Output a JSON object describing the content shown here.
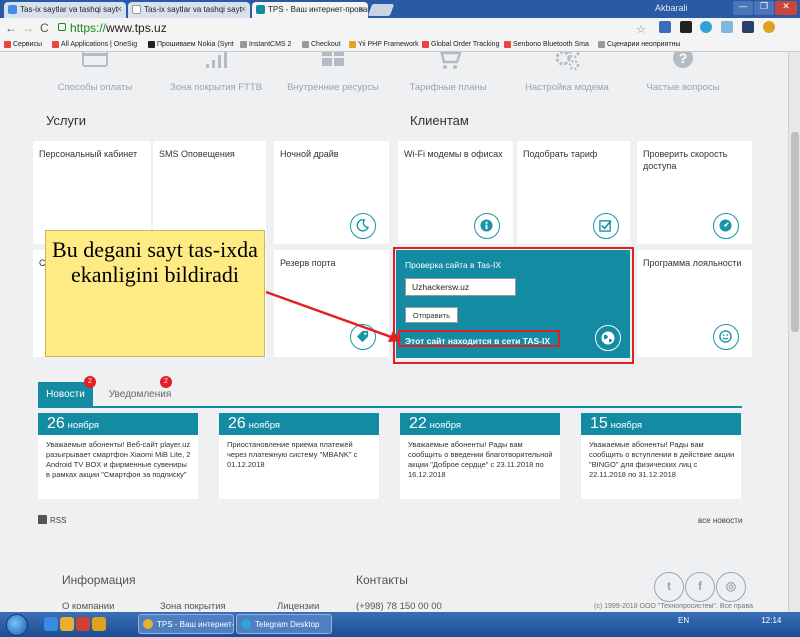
{
  "browser": {
    "tabs": [
      {
        "label": "Tas-ix saytlar va tashqi sayt"
      },
      {
        "label": "Tas-ix saytlar va tashqi sayt"
      },
      {
        "label": "TPS - Ваш интернет-провай"
      }
    ],
    "user": "Akbarali",
    "url_scheme": "https://",
    "url_host": "www.tps.uz",
    "bookmarks": [
      {
        "label": "Сервисы",
        "color": "#e8453c"
      },
      {
        "label": "All Applications | OneSig",
        "color": "#e8453c"
      },
      {
        "label": "Прошиваем Nokia (Synt",
        "color": "#222222"
      },
      {
        "label": "InstantCMS 2",
        "color": "#999999"
      },
      {
        "label": "Checkout",
        "color": "#999999"
      },
      {
        "label": "Yii PHP Framework",
        "color": "#e8a020"
      },
      {
        "label": "Global Order Tracking",
        "color": "#e8453c"
      },
      {
        "label": "Senbono Bluetooth Sma",
        "color": "#e8453c"
      },
      {
        "label": "Сценарии неоприятны",
        "color": "#999999"
      }
    ]
  },
  "topnav": [
    {
      "label": "Способы оплаты",
      "icon": "card-icon"
    },
    {
      "label": "Зона покрытия FTTB",
      "icon": "signal-icon"
    },
    {
      "label": "Внутренние ресурсы",
      "icon": "grid-icon"
    },
    {
      "label": "Тарифные планы",
      "icon": "cart-icon"
    },
    {
      "label": "Настройка модема",
      "icon": "gears-icon"
    },
    {
      "label": "Частые вопросы",
      "icon": "question-icon"
    }
  ],
  "sections": {
    "services": "Услуги",
    "clients": "Клиентам"
  },
  "cards_row1": [
    {
      "label": "Персональный кабинет",
      "icon": "login-icon"
    },
    {
      "label": "SMS Оповещения",
      "icon": "mail-icon"
    },
    {
      "label": "Ночной драйв",
      "icon": "moon-icon"
    },
    {
      "label": "Wi-Fi модемы в офисах",
      "icon": "info-icon"
    },
    {
      "label": "Подобрать тариф",
      "icon": "checkbox-icon"
    },
    {
      "label": "Проверить скорость доступа",
      "icon": "speedometer-icon"
    }
  ],
  "cards_row2": [
    {
      "label": "Ст",
      "icon": ""
    },
    {
      "label": "Резерв порта",
      "icon": "tag-icon"
    },
    {
      "label": "Программа лояльности",
      "icon": "smile-icon"
    }
  ],
  "tasix": {
    "title": "Проверка сайта в Tas-IX",
    "input_value": "Uzhackersw.uz",
    "submit_label": "Отправить",
    "result": "Этот сайт находится в сети TAS-IX",
    "accent": "#138ba2"
  },
  "annotation": {
    "text": "Bu degani sayt tas-ixda ekanligini bildiradi",
    "arrow_color": "#e31e24"
  },
  "news": {
    "tabs": [
      {
        "label": "Новости",
        "badge": "2"
      },
      {
        "label": "Уведомления",
        "badge": "2"
      }
    ],
    "items": [
      {
        "day": "26",
        "month": "ноября",
        "text": "Уважаемые абоненты! Веб-сайт player.uz разыгрывает смартфон Xiaomi MiB Lite, 2 Android TV BOX и фирменные сувениры в рамках акции \"Смартфон за подписку\""
      },
      {
        "day": "26",
        "month": "ноября",
        "text": "Приостановление приема платежей через платежную систему \"MBANK\" с 01.12.2018"
      },
      {
        "day": "22",
        "month": "ноября",
        "text": "Уважаемые абоненты! Рады вам сообщить о введении благотворительной акции \"Доброе сердце\" с 23.11.2018 по 16.12.2018"
      },
      {
        "day": "15",
        "month": "ноября",
        "text": "Уважаемые абоненты! Рады вам сообщить о вступлении в действие акции \"BINGO\" для физических лиц с 22.11.2018 по 31.12.2018"
      }
    ],
    "rss": "RSS",
    "all_news": "все новости"
  },
  "footer": {
    "info_title": "Информация",
    "contacts_title": "Контакты",
    "links": [
      "О компании",
      "Зона покрытия",
      "Лицензии"
    ],
    "phone": "(+998) 78 150 00 00",
    "copyright": "(c) 1999-2018 ООО \"Технопросистем\". Все права",
    "social": [
      "twitter-icon",
      "facebook-icon",
      "instagram-icon"
    ]
  },
  "taskbar": {
    "items": [
      "TPS - Ваш интернет-...",
      "Telegram Desktop"
    ],
    "lang": "EN",
    "time": "12:14"
  }
}
